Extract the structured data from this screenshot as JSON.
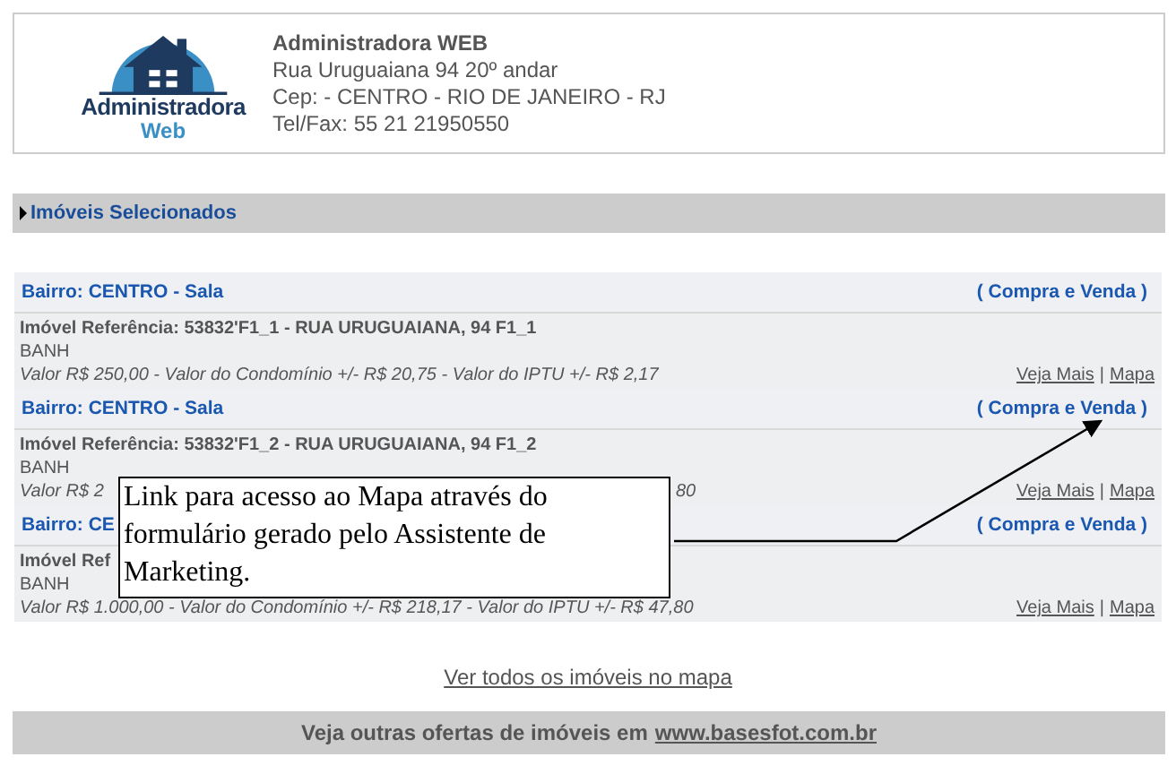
{
  "company": {
    "logo_text": "Administradora",
    "logo_sub": "Web",
    "name": "Administradora WEB",
    "address": "Rua Uruguaiana 94 20º andar",
    "cep": "Cep: - CENTRO - RIO DE JANEIRO - RJ",
    "phone": "Tel/Fax: 55 21 21950550"
  },
  "section_title": "Imóveis Selecionados",
  "listings": [
    {
      "bairro": "Bairro: CENTRO - Sala",
      "deal": "( Compra e Venda )",
      "reference": "Imóvel Referência: 53832'F1_1 - RUA URUGUAIANA, 94 F1_1",
      "type": "BANH",
      "value": "Valor R$ 250,00 - Valor do Condomínio +/- R$ 20,75 - Valor do IPTU +/- R$ 2,17",
      "links": [
        "Veja Mais",
        "Mapa"
      ],
      "separator": "|"
    },
    {
      "bairro": "Bairro: CENTRO - Sala",
      "deal": "( Compra e Venda )",
      "reference": "Imóvel Referência: 53832'F1_2 - RUA URUGUAIANA, 94 F1_2",
      "type": "BANH",
      "value": "Valor R$ 2",
      "value_tail": "80",
      "links": [
        "Veja Mais",
        "Mapa"
      ],
      "separator": "|"
    },
    {
      "bairro": "Bairro: CE",
      "deal": "( Compra e Venda )",
      "reference": "Imóvel Ref",
      "type": "BANH",
      "value": "Valor R$ 1.000,00 - Valor do Condomínio +/- R$ 218,17 - Valor do IPTU +/- R$ 47,80",
      "links": [
        "Veja Mais",
        "Mapa"
      ],
      "separator": "|"
    }
  ],
  "map_link": "Ver todos os imóveis no mapa",
  "footer": {
    "text": "Veja outras ofertas de imóveis em",
    "link": "www.basesfot.com.br"
  },
  "callout": "Link para acesso ao Mapa através do formulário gerado pelo Assistente de Marketing."
}
